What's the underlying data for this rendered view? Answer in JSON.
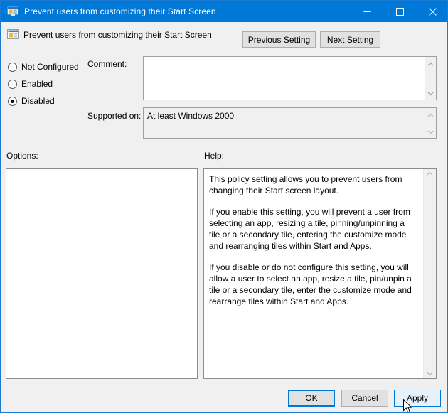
{
  "window": {
    "title": "Prevent users from customizing their Start Screen",
    "icon": "policy-screen-icon",
    "accent_color": "#0078d7",
    "border_color": "#1b7ad1",
    "caption": {
      "minimize": "minimize-icon",
      "maximize": "maximize-icon",
      "close": "close-icon"
    }
  },
  "header": {
    "policy_name": "Prevent users from customizing their Start Screen",
    "icon": "policy-setting-icon",
    "previous_setting": "Previous Setting",
    "next_setting": "Next Setting"
  },
  "state": {
    "options": [
      {
        "label": "Not Configured",
        "selected": false
      },
      {
        "label": "Enabled",
        "selected": false
      },
      {
        "label": "Disabled",
        "selected": true
      }
    ]
  },
  "comment": {
    "label": "Comment:",
    "value": "",
    "placeholder": ""
  },
  "supported": {
    "label": "Supported on:",
    "value": "At least Windows 2000"
  },
  "panels": {
    "options_label": "Options:",
    "options_content": "",
    "help_label": "Help:",
    "help_paragraphs": [
      "This policy setting allows you to prevent users from changing their Start screen layout.",
      "If you enable this setting, you will prevent a user from selecting an app, resizing a tile, pinning/unpinning a tile or a secondary tile, entering the customize mode and rearranging tiles within Start and Apps.",
      "If you disable or do not configure this setting, you will allow a user to select an app, resize a tile, pin/unpin a tile or a secondary tile, enter the customize mode and rearrange tiles within Start and Apps."
    ]
  },
  "footer": {
    "ok": "OK",
    "cancel": "Cancel",
    "apply": "Apply"
  }
}
